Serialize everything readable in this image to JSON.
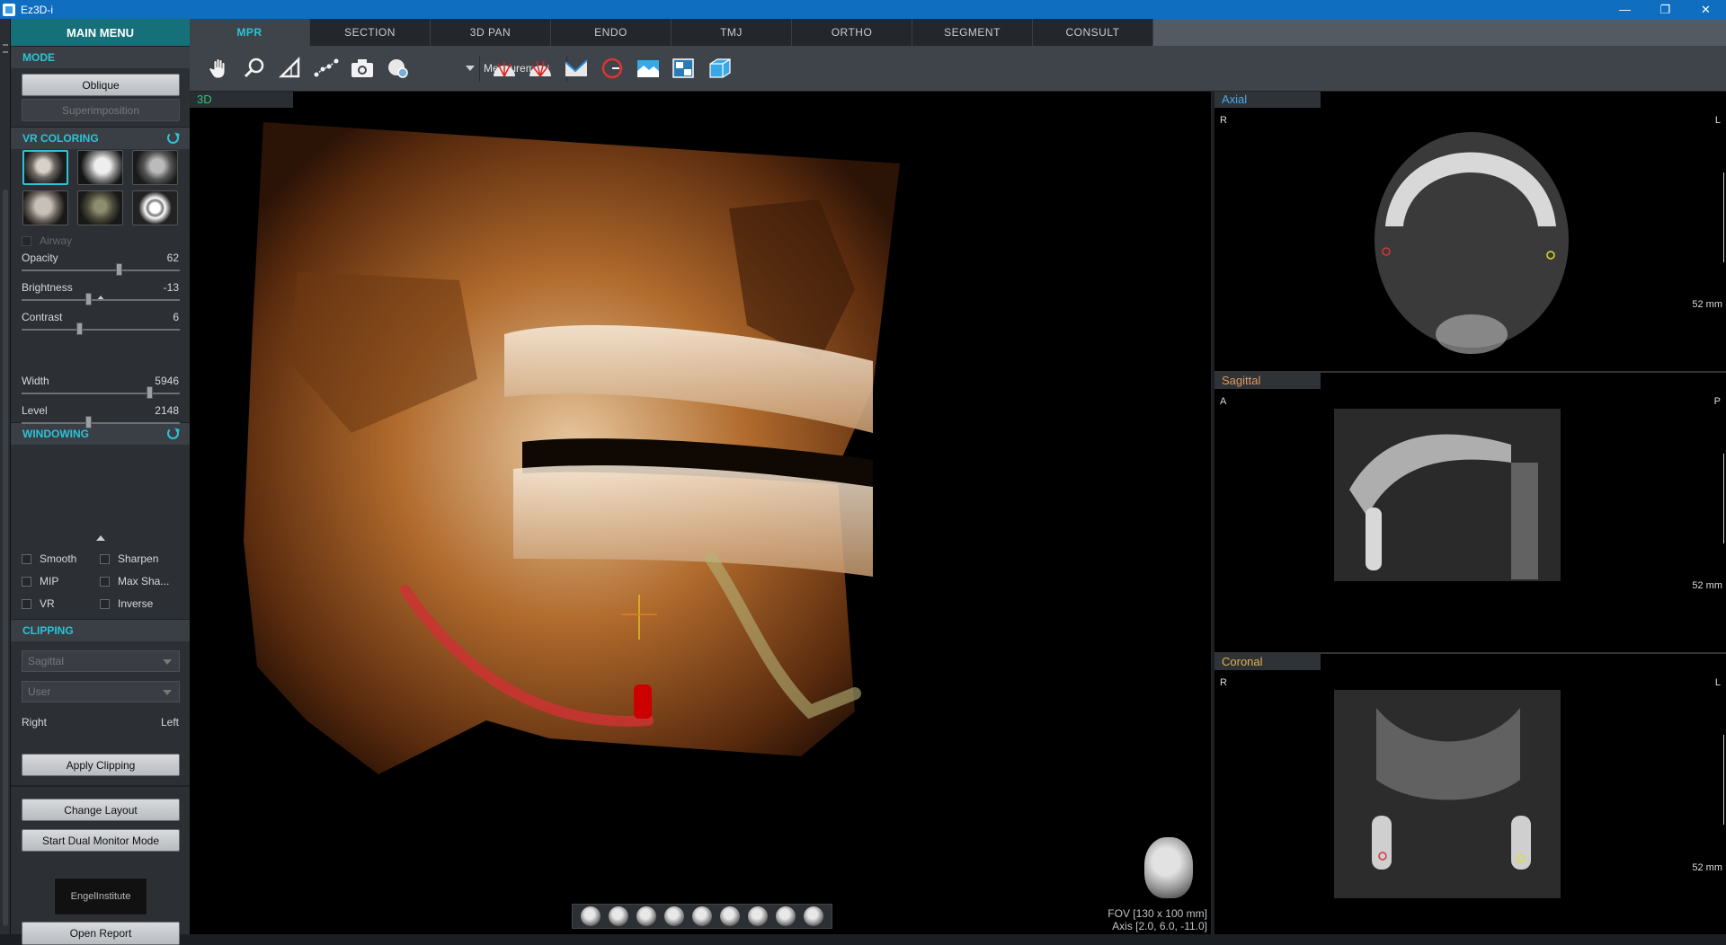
{
  "window": {
    "title": "Ez3D-i",
    "controls": [
      "—",
      "❐",
      "✕"
    ]
  },
  "left": {
    "main_menu": "MAIN MENU",
    "mode": {
      "title": "MODE",
      "oblique": "Oblique",
      "superimposition": "Superimposition"
    },
    "vr_coloring": {
      "title": "VR COLORING",
      "airway": "Airway"
    },
    "sliders": [
      {
        "label": "Opacity",
        "value": "62",
        "level": 0.62
      },
      {
        "label": "Brightness",
        "value": "-13",
        "level": 0.42
      },
      {
        "label": "Contrast",
        "value": "6",
        "level": 0.36
      }
    ],
    "windowing": {
      "title": "WINDOWING",
      "sliders": [
        {
          "label": "Width",
          "value": "5946",
          "level": 0.82
        },
        {
          "label": "Level",
          "value": "2148",
          "level": 0.42
        }
      ]
    },
    "checks": {
      "smooth": "Smooth",
      "sharpen": "Sharpen",
      "mip": "MIP",
      "maxsha": "Max Sha...",
      "vr": "VR",
      "inverse": "Inverse"
    },
    "clipping": {
      "title": "CLIPPING",
      "plane": "Sagittal",
      "mode": "User",
      "right": "Right",
      "left_side": "Left",
      "apply": "Apply Clipping"
    },
    "change_layout": "Change Layout",
    "dual_monitor": "Start Dual Monitor Mode",
    "logo": "EngelInstitute",
    "open_report": "Open Report"
  },
  "tabs": [
    "MPR",
    "SECTION",
    "3D PAN",
    "ENDO",
    "TMJ",
    "ORTHO",
    "SEGMENT",
    "CONSULT"
  ],
  "toolbar": {
    "measurement": "Measurement"
  },
  "viewer3d": {
    "label": "3D",
    "fov": "FOV [130 x 100 mm]",
    "axis": "Axis [2.0, 6.0, -11.0]"
  },
  "slices": [
    {
      "label": "Axial",
      "color": "#4aa8e8",
      "left": "R",
      "right": "L",
      "scale": "52 mm"
    },
    {
      "label": "Sagittal",
      "color": "#e09a5a",
      "left": "A",
      "right": "P",
      "scale": "52 mm"
    },
    {
      "label": "Coronal",
      "color": "#e0b04a",
      "left": "R",
      "right": "L",
      "scale": "52 mm"
    }
  ]
}
